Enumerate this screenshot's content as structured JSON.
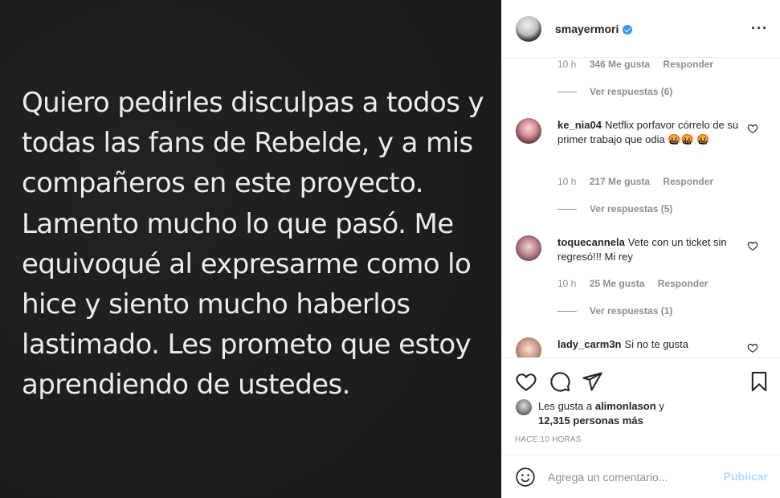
{
  "post": {
    "lines": [
      "Quiero pedirles disculpas a todos y",
      "todas las fans de Rebelde, y a mis",
      "compañeros en este proyecto.",
      "Lamento mucho lo que pasó. Me",
      "equivoqué al expresarme como lo",
      "hice y siento mucho haberlos",
      "lastimado. Les prometo que estoy",
      "aprendiendo de ustedes."
    ]
  },
  "header": {
    "username": "smayermori",
    "more_icon": "···"
  },
  "comments": {
    "first_meta": {
      "time": "10 h",
      "likes": "346 Me gusta",
      "reply": "Responder"
    },
    "first_view_replies": "Ver respuestas (6)",
    "items": [
      {
        "user": "ke_nia04",
        "text": "Netflix porfavor córrelo de su primer trabajo que odia 🤬🤬 🤬",
        "time": "10 h",
        "likes": "217 Me gusta",
        "reply": "Responder",
        "view_replies": "Ver respuestas (5)"
      },
      {
        "user": "toquecannela",
        "text": "Vete con un ticket sin regresó!!! Mi rey",
        "time": "10 h",
        "likes": "25 Me gusta",
        "reply": "Responder",
        "view_replies": "Ver respuestas (1)"
      },
      {
        "user": "lady_carm3n",
        "text": "Si no te gusta",
        "time": "",
        "likes": "",
        "reply": "",
        "view_replies": ""
      }
    ]
  },
  "actions": {
    "liked_prefix": "Les gusta a",
    "liked_user": "alimonlason",
    "liked_and": "y",
    "liked_count": "12,315 personas más",
    "time_ago": "HACE 10 HORAS"
  },
  "add_comment": {
    "placeholder": "Agrega un comentario...",
    "publish": "Publicar"
  },
  "colors": {
    "image_bg": "#1c1c1e",
    "image_text": "#ececec",
    "verified": "#3897f0",
    "publish_disabled": "#b3dbff",
    "muted": "#8e8e8e"
  }
}
